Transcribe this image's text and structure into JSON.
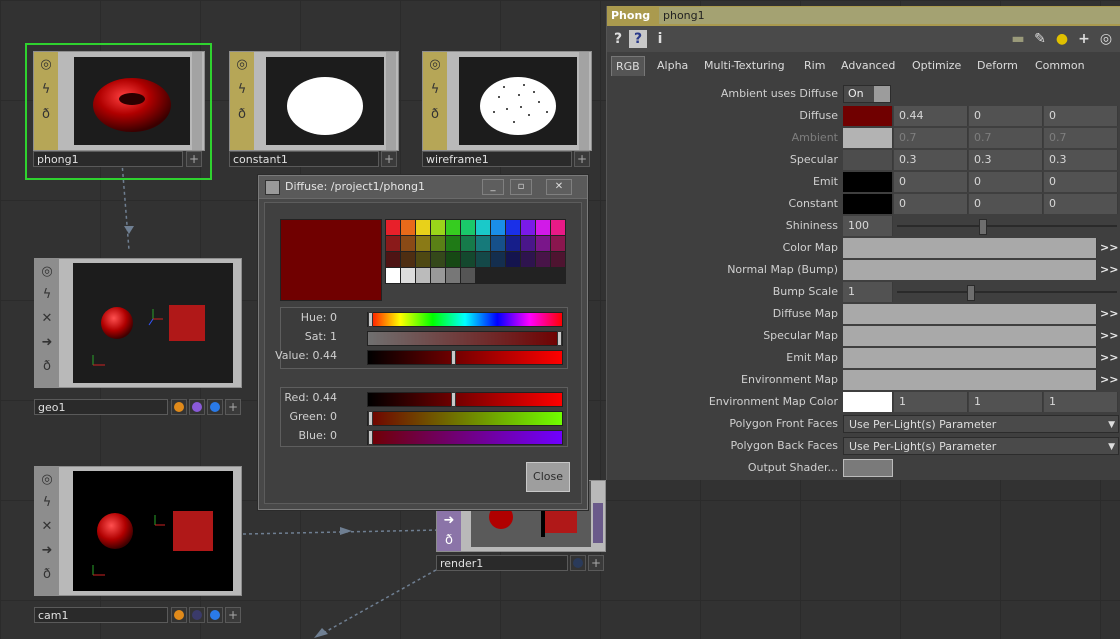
{
  "network": {
    "nodes": {
      "phong1": {
        "name": "phong1"
      },
      "constant1": {
        "name": "constant1"
      },
      "wireframe1": {
        "name": "wireframe1"
      },
      "geo1": {
        "name": "geo1"
      },
      "cam1": {
        "name": "cam1"
      },
      "render1": {
        "name": "render1"
      }
    }
  },
  "dialog": {
    "title": "Diffuse:  /project1/phong1",
    "color_hex": "#700000",
    "hsv": {
      "hue": "Hue: 0",
      "sat": "Sat: 1",
      "value": "Value: 0.44",
      "hue_pos": 0,
      "sat_pos": 1,
      "value_pos": 0.44
    },
    "rgb": {
      "red": "Red: 0.44",
      "green": "Green: 0",
      "blue": "Blue: 0",
      "red_pos": 0.44,
      "green_pos": 0,
      "blue_pos": 0
    },
    "palette": [
      "#e8202a",
      "#e86a1a",
      "#e8d11a",
      "#9ad51a",
      "#36cc20",
      "#1ac96a",
      "#1ac9c9",
      "#1a8ee8",
      "#1a30e8",
      "#7a1ae8",
      "#d11ae8",
      "#e81a86",
      "#8a1a1a",
      "#8a4a16",
      "#8a7a16",
      "#5a8016",
      "#1f7a16",
      "#167a4a",
      "#167a7a",
      "#16508a",
      "#161e8a",
      "#4a168a",
      "#7a168a",
      "#8a164e",
      "#4e1414",
      "#4e2e12",
      "#4e4812",
      "#34481a",
      "#164814",
      "#14482e",
      "#144848",
      "#142e4e",
      "#14144e",
      "#2e144e",
      "#481448",
      "#4e1430",
      "#ffffff",
      "#dddddd",
      "#bbbbbb",
      "#999999",
      "#777777",
      "#555555"
    ],
    "close_label": "Close"
  },
  "params": {
    "op_type": "Phong",
    "op_name": "phong1",
    "tabs": [
      "RGB",
      "Alpha",
      "Multi-Texturing",
      "Rim",
      "Advanced",
      "Optimize",
      "Deform",
      "Common"
    ],
    "active_tab": "RGB",
    "rows": {
      "ambient_uses_diffuse": {
        "label": "Ambient uses Diffuse",
        "value": "On"
      },
      "diffuse": {
        "label": "Diffuse",
        "v": [
          "0.44",
          "0",
          "0"
        ]
      },
      "ambient": {
        "label": "Ambient",
        "v": [
          "0.7",
          "0.7",
          "0.7"
        ]
      },
      "specular": {
        "label": "Specular",
        "v": [
          "0.3",
          "0.3",
          "0.3"
        ]
      },
      "emit": {
        "label": "Emit",
        "v": [
          "0",
          "0",
          "0"
        ]
      },
      "constant": {
        "label": "Constant",
        "v": [
          "0",
          "0",
          "0"
        ]
      },
      "shininess": {
        "label": "Shininess",
        "value": "100"
      },
      "color_map": {
        "label": "Color Map"
      },
      "normal_map": {
        "label": "Normal Map (Bump)"
      },
      "bump_scale": {
        "label": "Bump Scale",
        "value": "1"
      },
      "diffuse_map": {
        "label": "Diffuse Map"
      },
      "specular_map": {
        "label": "Specular Map"
      },
      "emit_map": {
        "label": "Emit Map"
      },
      "environment_map": {
        "label": "Environment Map"
      },
      "env_map_color": {
        "label": "Environment Map Color",
        "v": [
          "1",
          "1",
          "1"
        ]
      },
      "poly_front": {
        "label": "Polygon Front Faces",
        "value": "Use Per-Light(s) Parameter"
      },
      "poly_back": {
        "label": "Polygon Back Faces",
        "value": "Use Per-Light(s) Parameter"
      },
      "output_shader": {
        "label": "Output Shader..."
      }
    },
    "more": ">>"
  }
}
